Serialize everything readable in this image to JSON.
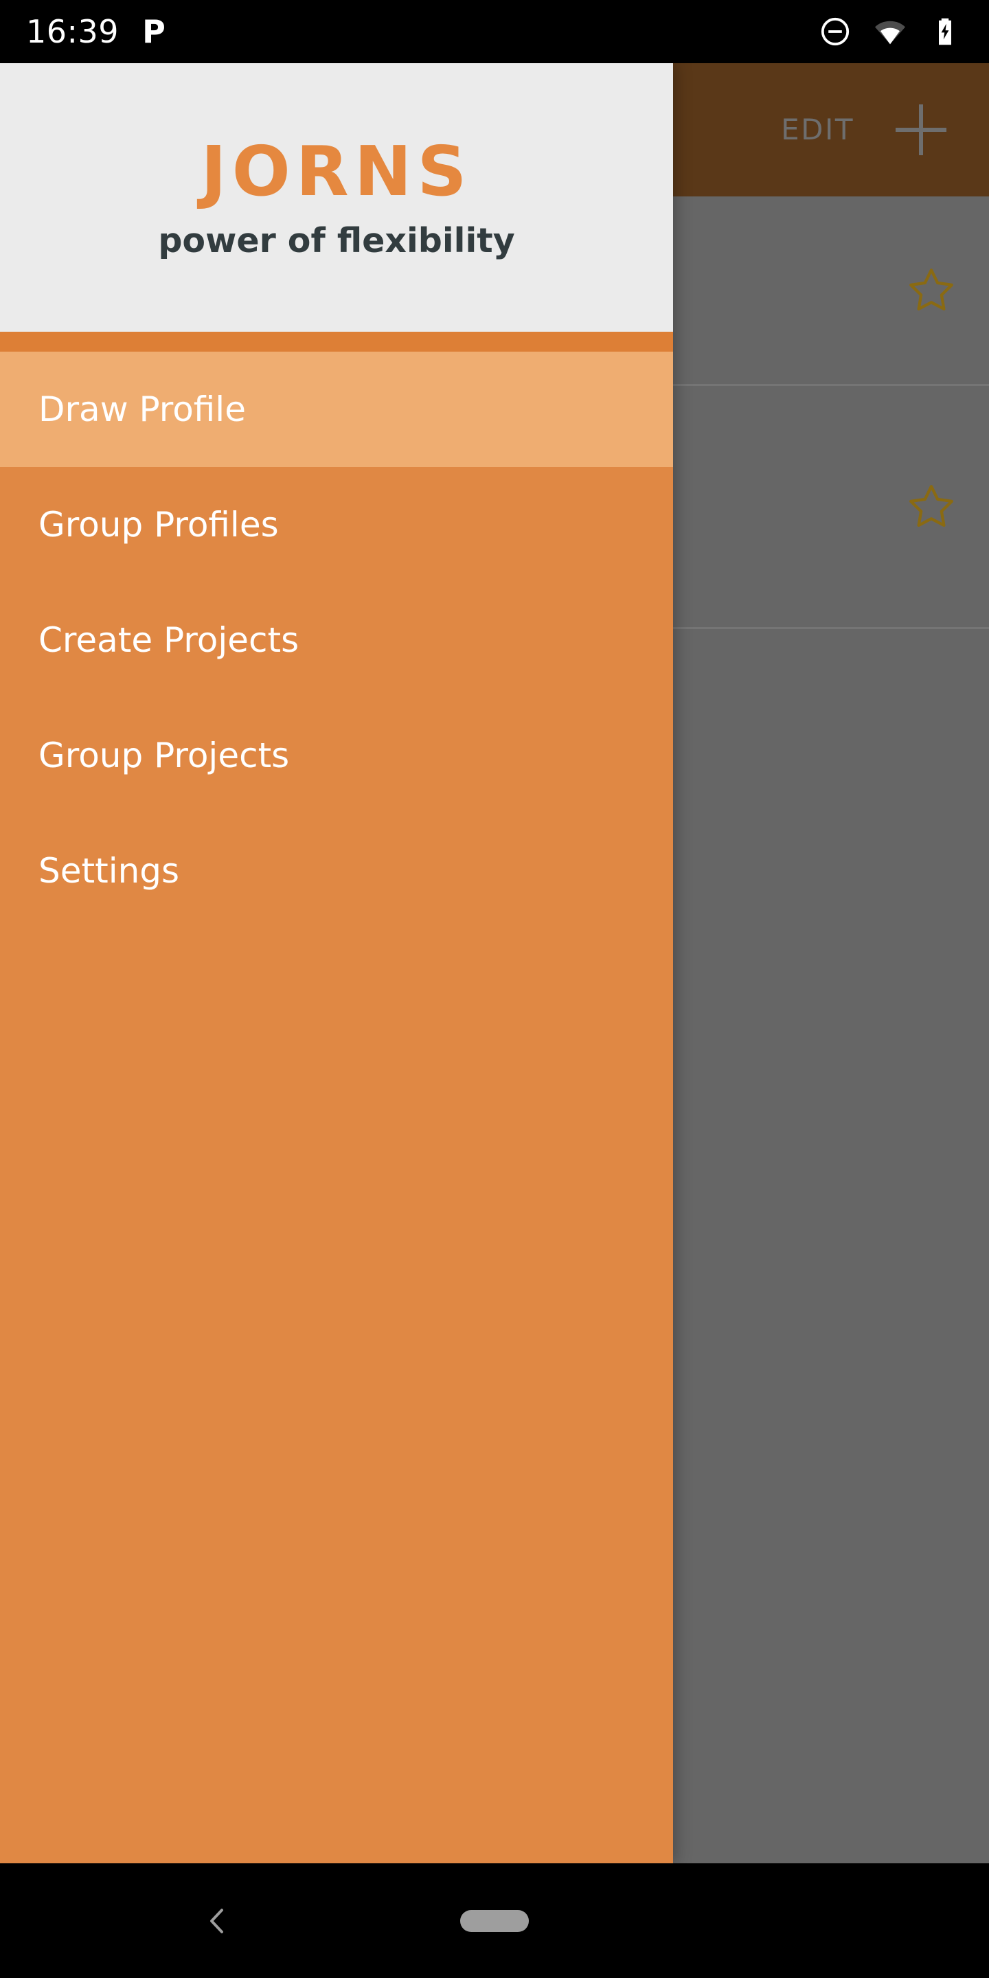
{
  "status_bar": {
    "time": "16:39",
    "app_indicator_icon": "parking-p-icon",
    "app_indicator_label": "P",
    "icons": [
      {
        "name": "do-not-disturb-icon",
        "label": "Do not disturb"
      },
      {
        "name": "wifi-icon",
        "label": "Wi-Fi"
      },
      {
        "name": "battery-charging-icon",
        "label": "Battery charging"
      }
    ]
  },
  "drawer": {
    "brand": {
      "logo_text": "JORNS",
      "tagline": "power of flexibility",
      "logo_color": "#E5883F",
      "tagline_color": "#323C3F",
      "header_bg": "#EBEBEB"
    },
    "background_color": "#E08844",
    "divider_color": "#DD7F36",
    "selected_color": "#EFAD71",
    "label_color": "#FFFFFF",
    "items": [
      {
        "label": "Draw Profile",
        "selected": true
      },
      {
        "label": "Group Profiles",
        "selected": false
      },
      {
        "label": "Create Projects",
        "selected": false
      },
      {
        "label": "Group Projects",
        "selected": false
      },
      {
        "label": "Settings",
        "selected": false
      }
    ]
  },
  "app": {
    "app_bar": {
      "edit_label": "EDIT",
      "add_icon": "plus-icon",
      "background_color": "#5A3818",
      "content_color": "#6E6E6E"
    },
    "content_background": "#666666",
    "list_rows": [
      {
        "title": "",
        "favorite_icon": "star-outline-icon",
        "has_star": false
      },
      {
        "title": "",
        "favorite_icon": "star-outline-icon",
        "has_star": true
      },
      {
        "title": "",
        "favorite_icon": "star-outline-icon",
        "has_star": true
      }
    ],
    "star_color": "#8A6A12",
    "divider_color": "#757575"
  },
  "nav_bar": {
    "back_icon": "back-chevron-icon",
    "home_icon": "home-pill-icon",
    "background_color": "#000000"
  }
}
